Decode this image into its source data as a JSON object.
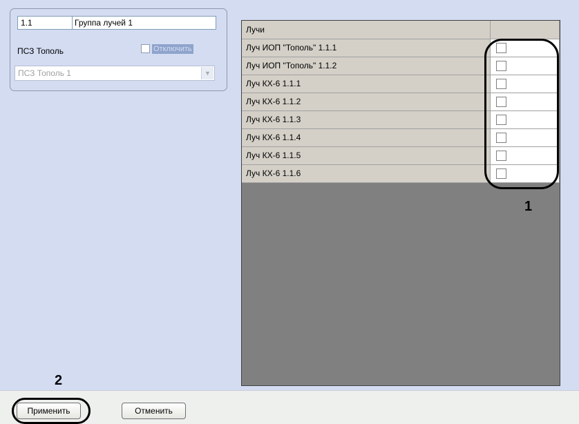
{
  "group": {
    "id_value": "1.1",
    "name_value": "Группа лучей 1",
    "device_label": "ПСЗ Тополь",
    "disable_label": "Отключить",
    "disable_checked": false,
    "device_select_value": "ПСЗ Тополь 1"
  },
  "rays_table": {
    "header": "Лучи",
    "rows": [
      {
        "name": "Луч ИОП \"Тополь\" 1.1.1",
        "checked": false
      },
      {
        "name": "Луч ИОП \"Тополь\" 1.1.2",
        "checked": false
      },
      {
        "name": "Луч КХ-6 1.1.1",
        "checked": false
      },
      {
        "name": "Луч КХ-6 1.1.2",
        "checked": false
      },
      {
        "name": "Луч КХ-6 1.1.3",
        "checked": false
      },
      {
        "name": "Луч КХ-6 1.1.4",
        "checked": false
      },
      {
        "name": "Луч КХ-6 1.1.5",
        "checked": false
      },
      {
        "name": "Луч КХ-6 1.1.6",
        "checked": false
      }
    ]
  },
  "callouts": {
    "one": "1",
    "two": "2"
  },
  "buttons": {
    "apply_label": "Применить",
    "cancel_label": "Отменить"
  }
}
